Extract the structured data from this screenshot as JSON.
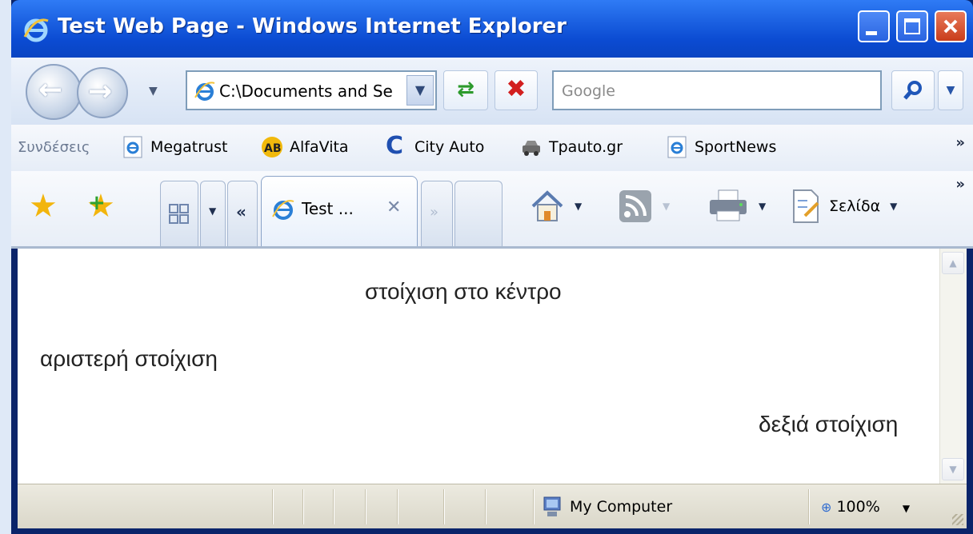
{
  "window": {
    "title": "Test Web Page - Windows Internet Explorer"
  },
  "navbar": {
    "address": "C:\\Documents and Se",
    "search_placeholder": "Google"
  },
  "links": {
    "label": "Συνδέσεις",
    "items": [
      {
        "label": "Megatrust",
        "icon": "ie-page-icon"
      },
      {
        "label": "AlfaVita",
        "icon": "ab-logo-icon"
      },
      {
        "label": "City Auto",
        "icon": "c-logo-icon"
      },
      {
        "label": "Tpauto.gr",
        "icon": "car-icon"
      },
      {
        "label": "SportNews",
        "icon": "ie-page-icon"
      }
    ],
    "overflow": "»"
  },
  "cmdbar": {
    "tab_label": "Test ...",
    "page_label": "Σελίδα",
    "overflow": "»"
  },
  "content": {
    "center_text": "στοίχιση στο κέντρο",
    "left_text": "αριστερή στοίχιση",
    "right_text": "δεξιά στοίχιση"
  },
  "status": {
    "zone": "My Computer",
    "zoom": "100%"
  },
  "colors": {
    "titlebar": "#0b4bd2",
    "close": "#c93d1b",
    "content_bg": "#ffffff"
  }
}
